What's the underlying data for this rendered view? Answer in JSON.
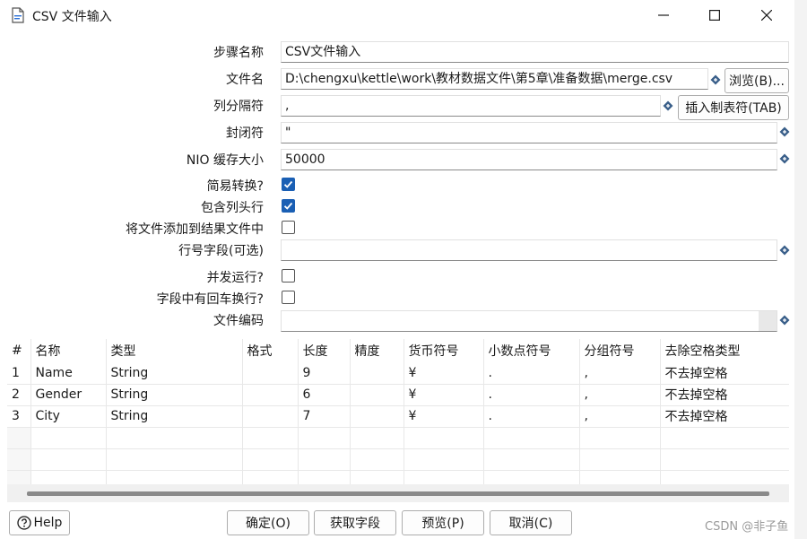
{
  "window": {
    "title": "CSV 文件输入"
  },
  "form": {
    "step_name_label": "步骤名称",
    "step_name_value": "CSV文件输入",
    "filename_label": "文件名",
    "filename_value": "D:\\chengxu\\kettle\\work\\教材数据文件\\第5章\\准备数据\\merge.csv",
    "browse_label": "浏览(B)...",
    "delimiter_label": "列分隔符",
    "delimiter_value": ",",
    "insert_tab_label": "插入制表符(TAB)",
    "enclosure_label": "封闭符",
    "enclosure_value": "\"",
    "nio_label": "NIO 缓存大小",
    "nio_value": "50000",
    "lazy_conversion_label": "简易转换?",
    "lazy_conversion_checked": true,
    "header_row_label": "包含列头行",
    "header_row_checked": true,
    "add_to_result_label": "将文件添加到结果文件中",
    "add_to_result_checked": false,
    "row_number_label": "行号字段(可选)",
    "row_number_value": "",
    "parallel_label": "并发运行?",
    "parallel_checked": false,
    "newline_label": "字段中有回车换行?",
    "newline_checked": false,
    "encoding_label": "文件编码",
    "encoding_value": ""
  },
  "table": {
    "columns": [
      "#",
      "名称",
      "类型",
      "格式",
      "长度",
      "精度",
      "货币符号",
      "小数点符号",
      "分组符号",
      "去除空格类型"
    ],
    "rows": [
      [
        "1",
        "Name",
        "String",
        "",
        "9",
        "",
        "¥",
        ".",
        ",",
        "不去掉空格"
      ],
      [
        "2",
        "Gender",
        "String",
        "",
        "6",
        "",
        "¥",
        ".",
        ",",
        "不去掉空格"
      ],
      [
        "3",
        "City",
        "String",
        "",
        "7",
        "",
        "¥",
        ".",
        ",",
        "不去掉空格"
      ]
    ]
  },
  "footer": {
    "help_label": "Help",
    "ok_label": "确定(O)",
    "get_fields_label": "获取字段",
    "preview_label": "预览(P)",
    "cancel_label": "取消(C)"
  },
  "watermark": "CSDN @非子鱼",
  "icons": {
    "app": "document-icon",
    "variable": "variable-diamond-icon",
    "help": "question-icon"
  }
}
